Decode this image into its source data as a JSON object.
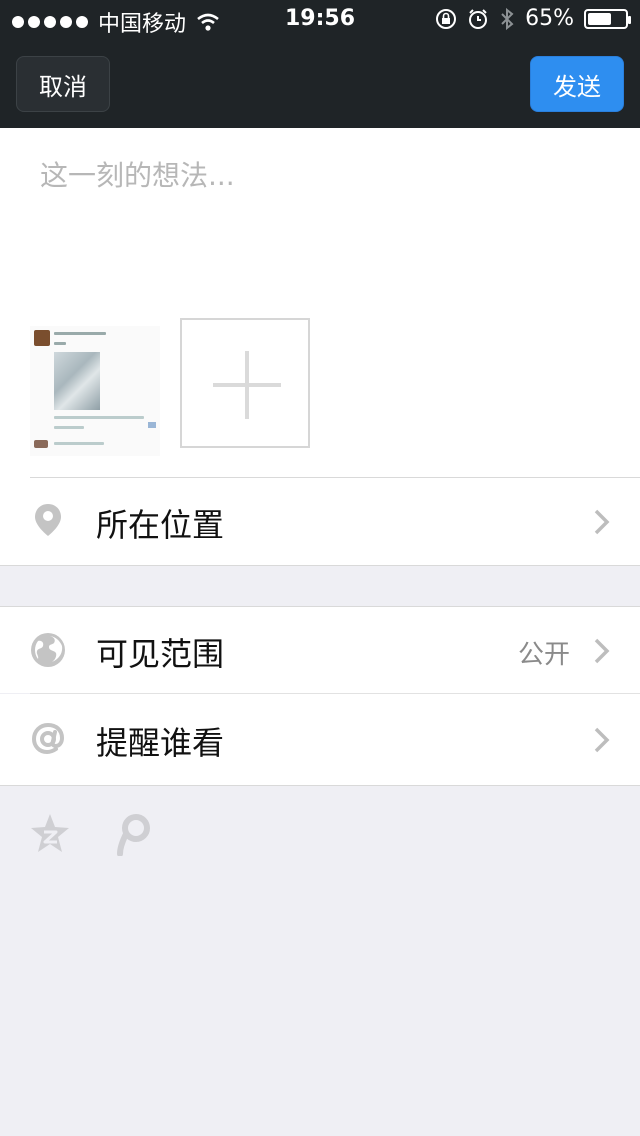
{
  "status_bar": {
    "carrier": "中国移动",
    "time": "19:56",
    "battery": "65%",
    "battery_level": 0.65
  },
  "nav": {
    "cancel_label": "取消",
    "send_label": "发送"
  },
  "composer": {
    "placeholder": "这一刻的想法...",
    "value": ""
  },
  "rows": {
    "location": {
      "label": "所在位置",
      "icon": "location-pin-icon"
    },
    "visibility": {
      "label": "可见范围",
      "value": "公开",
      "icon": "globe-icon"
    },
    "mention": {
      "label": "提醒谁看",
      "icon": "at-icon"
    }
  },
  "share_icons": [
    "qzone-star-icon",
    "tencent-weibo-icon"
  ],
  "colors": {
    "nav_bg": "#1f2427",
    "send_button": "#2e8ef0",
    "page_bg": "#efeff4",
    "icon_gray": "#c4c4c4"
  }
}
